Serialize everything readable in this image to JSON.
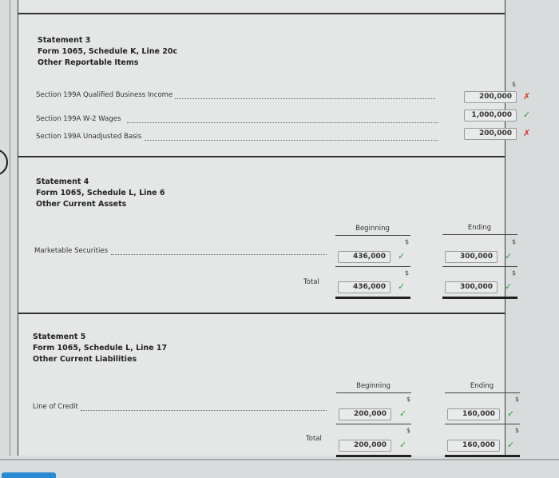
{
  "statements": [
    {
      "title": "Statement 3",
      "form_line": "Form 1065, Schedule K, Line 20c",
      "subtitle": "Other Reportable Items",
      "currency_symbol": "$",
      "rows": [
        {
          "label": "Section 199A Qualified Business Income",
          "value": "200,000",
          "status": "incorrect",
          "mark": "✗"
        },
        {
          "label": "Section 199A W-2 Wages",
          "value": "1,000,000",
          "status": "correct",
          "mark": "✓"
        },
        {
          "label": "Section 199A Unadjusted Basis",
          "value": "200,000",
          "status": "incorrect",
          "mark": "✗"
        }
      ]
    },
    {
      "title": "Statement 4",
      "form_line": "Form 1065, Schedule L, Line 6",
      "subtitle": "Other Current Assets",
      "columns": [
        "Beginning",
        "Ending"
      ],
      "currency_symbol": "$",
      "rows": [
        {
          "label": "Marketable Securities",
          "beginning": "436,000",
          "beginning_mark": "✓",
          "ending": "300,000",
          "ending_mark": "✓"
        }
      ],
      "total": {
        "label": "Total",
        "beginning": "436,000",
        "beginning_mark": "✓",
        "ending": "300,000",
        "ending_mark": "✓"
      }
    },
    {
      "title": "Statement 5",
      "form_line": "Form 1065, Schedule L, Line 17",
      "subtitle": "Other Current Liabilities",
      "columns": [
        "Beginning",
        "Ending"
      ],
      "currency_symbol": "$",
      "rows": [
        {
          "label": "Line of Credit",
          "beginning": "200,000",
          "beginning_mark": "✓",
          "ending": "160,000",
          "ending_mark": "✓"
        }
      ],
      "total": {
        "label": "Total",
        "beginning": "200,000",
        "beginning_mark": "✓",
        "ending": "160,000",
        "ending_mark": "✓"
      }
    }
  ],
  "colors": {
    "correct": "#2f9a3a",
    "incorrect": "#d9302b",
    "accent_bar": "#2a8ad4"
  }
}
